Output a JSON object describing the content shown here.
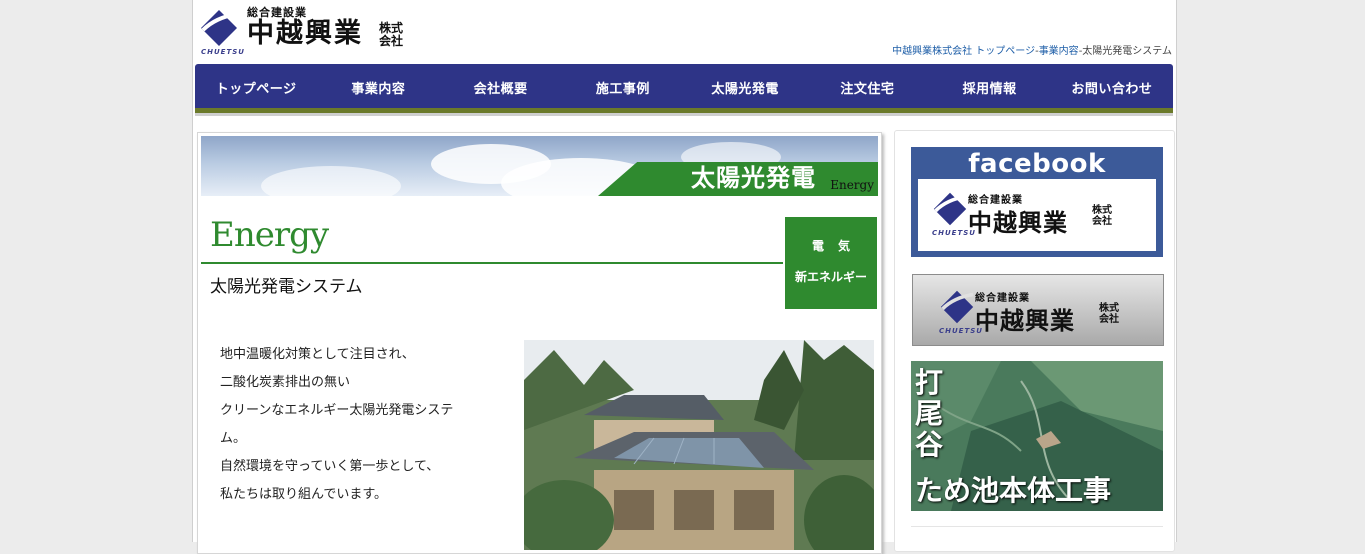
{
  "header": {
    "logo_small": "総合建設業",
    "logo_big": "中越興業",
    "logo_kabushiki": "株式会社",
    "logo_en": "CHUETSU",
    "breadcrumb": {
      "site": "中越興業株式会社",
      "home": "トップページ",
      "sep1": "-",
      "section": "事業内容",
      "sep2": "-",
      "current": "太陽光発電システム"
    }
  },
  "nav": {
    "items": [
      "トップページ",
      "事業内容",
      "会社概要",
      "施工事例",
      "太陽光発電",
      "注文住宅",
      "採用情報",
      "お問い合わせ"
    ]
  },
  "main": {
    "banner_title": "太陽光発電",
    "banner_en": "Energy",
    "energy_title": "Energy",
    "subtitle": "太陽光発電システム",
    "green_box": {
      "line1": "電気",
      "line2": "新エネルギー"
    },
    "paragraph": [
      "地中温暖化対策として注目され、",
      "二酸化炭素排出の無い",
      "クリーンなエネルギー太陽光発電システ",
      "ム。",
      "自然環境を守っていく第一歩として、",
      "私たちは取り組んでいます。"
    ]
  },
  "sidebar": {
    "facebook_label": "facebook",
    "aerial_line1": "打尾谷",
    "aerial_line2": "ため池本体工事"
  },
  "colors": {
    "nav_bg": "#2e3487",
    "green": "#2f8a2f",
    "facebook": "#3c5a99"
  }
}
